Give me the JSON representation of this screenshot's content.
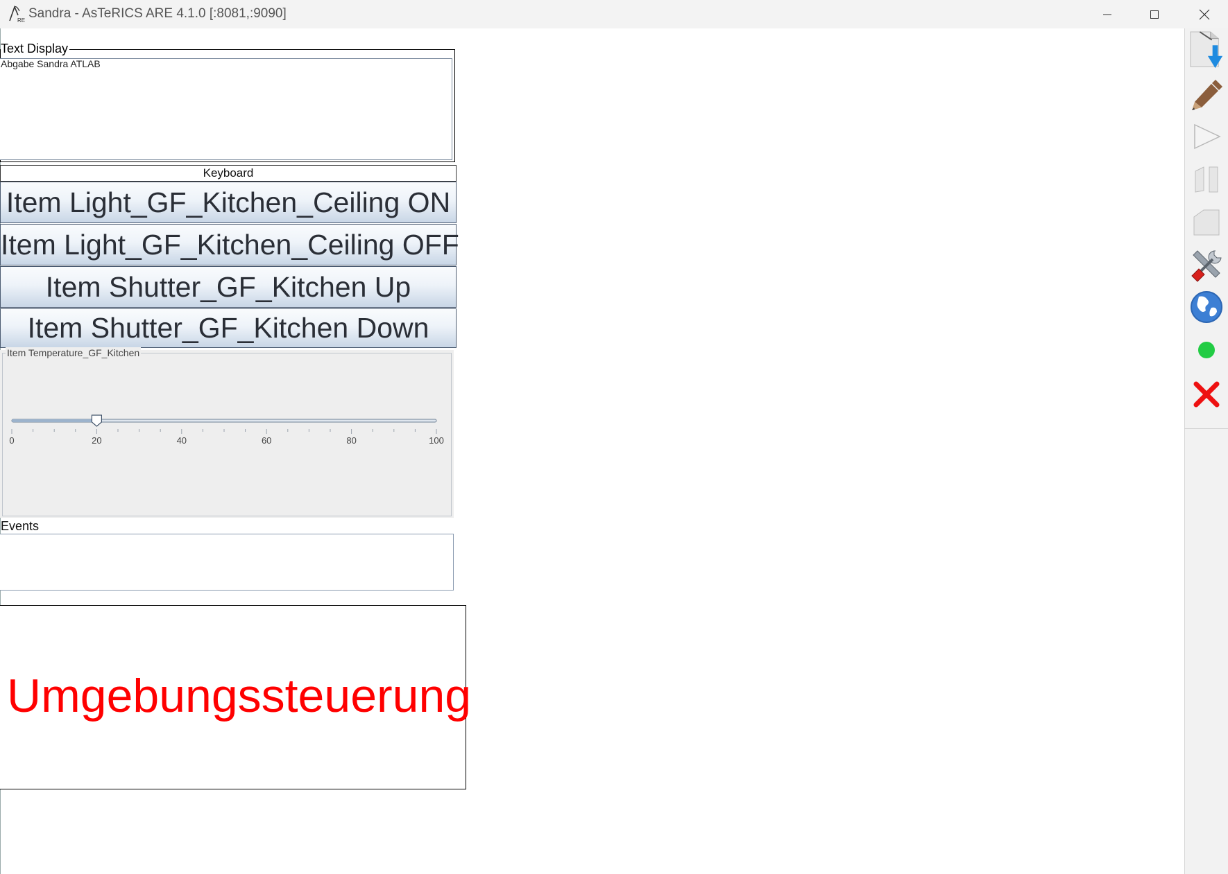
{
  "window": {
    "title": "Sandra - AsTeRICS ARE 4.1.0 [:8081,:9090]",
    "icon": "asterics-logo-icon",
    "controls": [
      "minimize-icon",
      "maximize-icon",
      "close-icon"
    ]
  },
  "text_display": {
    "label": "Text Display",
    "content": "Abgabe Sandra ATLAB"
  },
  "keyboard": {
    "label": "Keyboard",
    "buttons": [
      "Item Light_GF_Kitchen_Ceiling ON",
      "Item Light_GF_Kitchen_Ceiling OFF",
      "Item Shutter_GF_Kitchen Up",
      "Item Shutter_GF_Kitchen Down"
    ]
  },
  "slider": {
    "title": "Item Temperature_GF_Kitchen",
    "min": 0,
    "max": 100,
    "value": 20,
    "tick_labels": [
      "0",
      "20",
      "40",
      "60",
      "80",
      "100"
    ]
  },
  "events": {
    "label": "Events",
    "content": ""
  },
  "banner": {
    "text": "Umgebungssteuerung",
    "color": "#ff0000"
  },
  "toolbar": {
    "buttons": [
      "deploy-model-icon",
      "edit-pencil-icon",
      "start-play-icon",
      "pause-icon",
      "stop-icon",
      "settings-tools-icon",
      "web-globe-icon",
      "status-green-icon",
      "exit-red-x-icon"
    ],
    "status_color": "#22cc44",
    "exit_color": "#ee1111"
  }
}
